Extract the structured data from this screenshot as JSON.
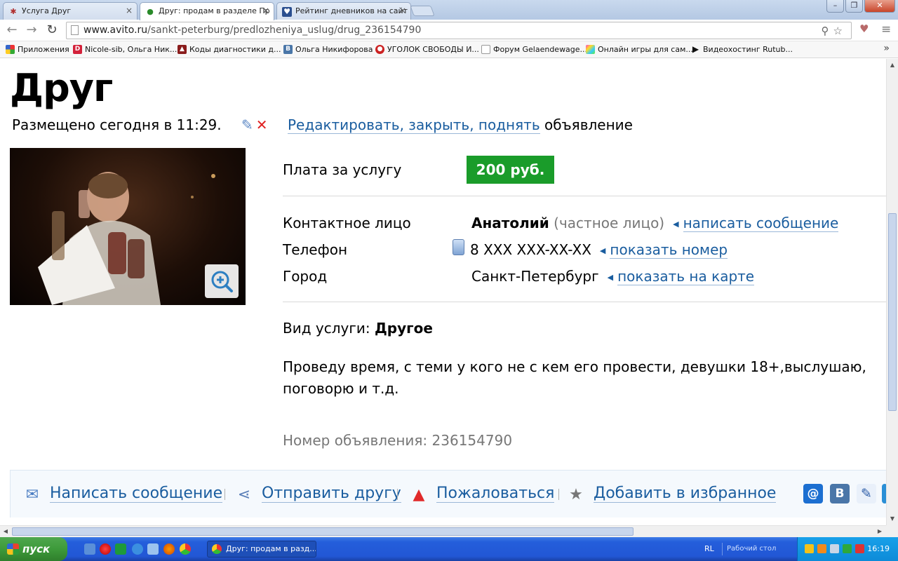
{
  "browser": {
    "tabs": [
      {
        "title": "Услуга Друг"
      },
      {
        "title": "Друг: продам в разделе Пр"
      },
      {
        "title": "Рейтинг дневников на сайт"
      }
    ],
    "url_host": "www.avito.ru",
    "url_path": "/sankt-peterburg/predlozheniya_uslug/drug_236154790",
    "bookmarks": [
      {
        "label": "Приложения",
        "icon": "apps-grid-icon"
      },
      {
        "label": "Nicole-sib, Ольга Ник...",
        "icon": "d-logo-icon"
      },
      {
        "label": "Коды диагностики д...",
        "icon": "car-icon"
      },
      {
        "label": "Ольга Никифорова",
        "icon": "vk-icon"
      },
      {
        "label": "УГОЛОК СВОБОДЫ И...",
        "icon": "ladybug-icon"
      },
      {
        "label": "Форум Gelaendewage...",
        "icon": "page-icon"
      },
      {
        "label": "Онлайн игры для сам...",
        "icon": "colorful-grid-icon"
      },
      {
        "label": "Видеохостинг Rutub...",
        "icon": "play-icon"
      }
    ]
  },
  "listing": {
    "title": "Друг",
    "posted": "Размещено сегодня в 11:29.",
    "edit_link": "Редактировать, закрыть, поднять",
    "edit_suffix": "объявление",
    "fields": {
      "price_label": "Плата за услугу",
      "price_value": "200 руб.",
      "contact_label": "Контактное лицо",
      "contact_name": "Анатолий",
      "contact_type": "(частное лицо)",
      "contact_link": "написать сообщение",
      "phone_label": "Телефон",
      "phone_value": "8 XXX XXX-XX-XX",
      "phone_link": "показать номер",
      "city_label": "Город",
      "city_value": "Санкт-Петербург",
      "city_link": "показать на карте"
    },
    "service_type_label": "Вид услуги:",
    "service_type_value": "Другое",
    "description": "Проведу время, с теми у кого не с кем его провести, девушки 18+,выслушаю, поговорю и т.д.",
    "ad_number": "Номер объявления: 236154790",
    "actions": [
      {
        "label": "Написать сообщение",
        "icon": "envelope-icon"
      },
      {
        "label": "Отправить другу",
        "icon": "share-icon"
      },
      {
        "label": "Пожаловаться",
        "icon": "warning-icon"
      },
      {
        "label": "Добавить в избранное",
        "icon": "star-icon"
      }
    ]
  },
  "taskbar": {
    "start_label": "пуск",
    "task_title": "Друг: продам в разд...",
    "lang": "RL",
    "desktop_label": "Рабочий стол",
    "clock": "16:19"
  },
  "colors": {
    "link": "#1a5d9f",
    "price_badge": "#1a9c2a",
    "taskbar": "#245edb"
  }
}
